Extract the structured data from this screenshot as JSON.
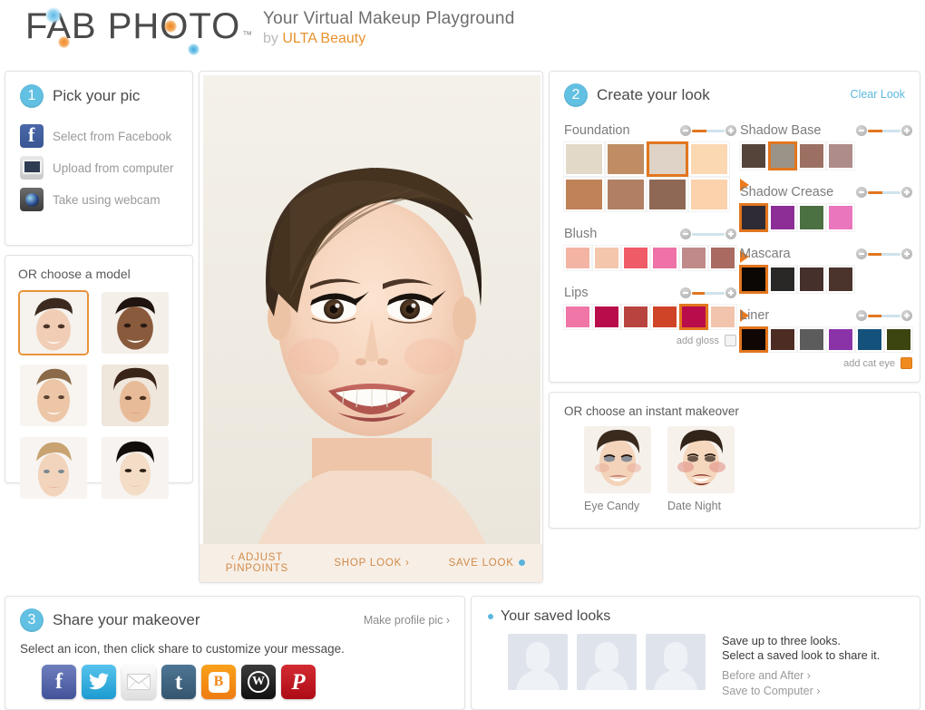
{
  "header": {
    "logo": "FAB PHOTO",
    "trademark": "™",
    "tagline": "Your Virtual Makeup Playground",
    "tagline_by": "by ",
    "tagline_brand": "ULTA Beauty"
  },
  "pick": {
    "step_number": "1",
    "title": "Pick your pic",
    "sources": [
      {
        "label": "Select from Facebook",
        "icon": "facebook-icon"
      },
      {
        "label": "Upload from computer",
        "icon": "computer-icon"
      },
      {
        "label": "Take using webcam",
        "icon": "webcam-icon"
      }
    ],
    "model_header": "OR choose a model",
    "models": [
      {
        "name": "model-1",
        "selected": true
      },
      {
        "name": "model-2",
        "selected": false
      },
      {
        "name": "model-3",
        "selected": false
      },
      {
        "name": "model-4",
        "selected": false
      },
      {
        "name": "model-5",
        "selected": false
      },
      {
        "name": "model-6",
        "selected": false
      }
    ]
  },
  "photo": {
    "actions": [
      {
        "label": "‹ ADJUST PINPOINTS",
        "dot": false
      },
      {
        "label": "SHOP LOOK ›",
        "dot": false
      },
      {
        "label": "SAVE LOOK",
        "dot": true
      }
    ]
  },
  "look": {
    "step_number": "2",
    "title": "Create your look",
    "clear_label": "Clear Look",
    "groups": [
      {
        "name": "foundation",
        "title": "Foundation",
        "slider": 45,
        "layout": "grid",
        "swatches": [
          {
            "color": "#e3d9c8",
            "selected": false
          },
          {
            "color": "#bf8c63",
            "selected": false
          },
          {
            "color": "#ded3c6",
            "selected": true
          },
          {
            "color": "#fbd7b2",
            "selected": false
          },
          {
            "color": "#c08257",
            "selected": false
          },
          {
            "color": "#b07f64",
            "selected": false
          },
          {
            "color": "#8e6855",
            "selected": false
          },
          {
            "color": "#fbd2ab",
            "selected": false
          }
        ]
      },
      {
        "name": "blush",
        "title": "Blush",
        "slider": 0,
        "layout": "row",
        "swatches": [
          {
            "color": "#f4b4a4",
            "selected": false
          },
          {
            "color": "#f4c6ab",
            "selected": false
          },
          {
            "color": "#f05b68",
            "selected": false
          },
          {
            "color": "#ee72a7",
            "selected": false
          },
          {
            "color": "#c08a8a",
            "selected": false
          },
          {
            "color": "#a96a61",
            "selected": false
          }
        ]
      },
      {
        "name": "lips",
        "title": "Lips",
        "slider": 40,
        "layout": "row",
        "swatches": [
          {
            "color": "#ef76a6",
            "selected": false
          },
          {
            "color": "#b90c4a",
            "selected": false
          },
          {
            "color": "#b8443f",
            "selected": false
          },
          {
            "color": "#cf4427",
            "selected": false
          },
          {
            "color": "#b90c4a",
            "selected": true
          },
          {
            "color": "#f2c4ae",
            "selected": false
          }
        ],
        "sub_option": {
          "label": "add gloss",
          "checked": false
        }
      },
      {
        "name": "shadow-base",
        "title": "Shadow Base",
        "slider": 45,
        "layout": "row",
        "swatches": [
          {
            "color": "#55443a",
            "selected": false
          },
          {
            "color": "#9a9488",
            "selected": true
          },
          {
            "color": "#9b7062",
            "selected": false
          },
          {
            "color": "#ae8c89",
            "selected": false
          }
        ]
      },
      {
        "name": "shadow-crease",
        "title": "Shadow Crease",
        "slider": 45,
        "layout": "row",
        "swatches": [
          {
            "color": "#2e2b34",
            "selected": true
          },
          {
            "color": "#8c2e96",
            "selected": false
          },
          {
            "color": "#4b7041",
            "selected": false
          },
          {
            "color": "#ea77bd",
            "selected": false
          }
        ]
      },
      {
        "name": "mascara",
        "title": "Mascara",
        "slider": 42,
        "layout": "row",
        "swatches": [
          {
            "color": "#0b0705",
            "selected": true
          },
          {
            "color": "#2a2826",
            "selected": false
          },
          {
            "color": "#45302c",
            "selected": false
          },
          {
            "color": "#4a342c",
            "selected": false
          }
        ]
      },
      {
        "name": "liner",
        "title": "Liner",
        "slider": 42,
        "layout": "row",
        "swatches": [
          {
            "color": "#100705",
            "selected": true
          },
          {
            "color": "#4d2c23",
            "selected": false
          },
          {
            "color": "#5c5c5c",
            "selected": false
          },
          {
            "color": "#8a33a8",
            "selected": false
          },
          {
            "color": "#14527c",
            "selected": false
          },
          {
            "color": "#3c4410",
            "selected": false
          }
        ],
        "sub_option": {
          "label": "add cat eye",
          "checked": true
        }
      }
    ]
  },
  "makeover": {
    "header": "OR choose  an instant makeover",
    "items": [
      {
        "label": "Eye Candy"
      },
      {
        "label": "Date Night"
      }
    ]
  },
  "share": {
    "step_number": "3",
    "title": "Share your makeover",
    "profile_link": "Make profile pic ›",
    "subtitle": "Select an icon, then click share to customize your message.",
    "icons": [
      {
        "name": "facebook-share-icon",
        "glyph": "f"
      },
      {
        "name": "twitter-share-icon",
        "glyph": ""
      },
      {
        "name": "email-share-icon",
        "glyph": ""
      },
      {
        "name": "tumblr-share-icon",
        "glyph": "t"
      },
      {
        "name": "blogger-share-icon",
        "glyph": "B"
      },
      {
        "name": "wordpress-share-icon",
        "glyph": "W"
      },
      {
        "name": "pinterest-share-icon",
        "glyph": "P"
      }
    ]
  },
  "saved": {
    "title": "Your saved looks",
    "slots": [
      "slot-1",
      "slot-2",
      "slot-3"
    ],
    "line1": "Save up to three looks.",
    "line2": "Select a saved look to share it.",
    "link1": "Before and After ›",
    "link2": "Save to Computer ›"
  },
  "colors": {
    "accent_orange": "#e2761f",
    "accent_blue": "#62c0e2",
    "link_blue": "#5bb7e0",
    "brand_orange": "#e8922f"
  }
}
